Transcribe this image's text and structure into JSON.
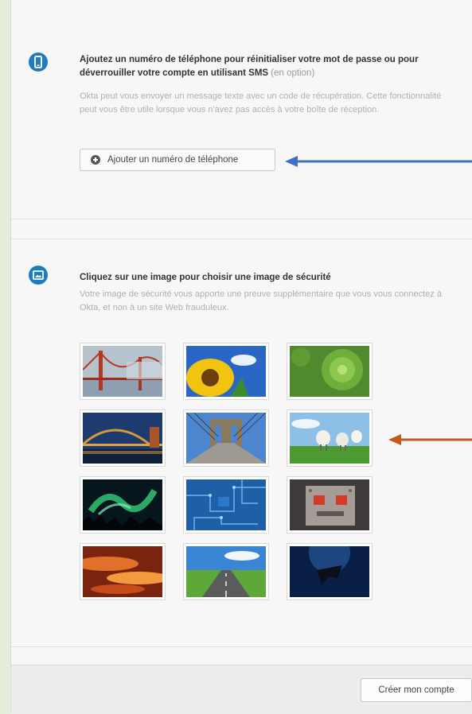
{
  "phone_section": {
    "icon": "phone-icon",
    "title": "Ajoutez un numéro de téléphone pour réinitialiser votre mot de passe ou pour déverrouiller votre compte en utilisant SMS",
    "optional": "(en option)",
    "description": "Okta peut vous envoyer un message texte avec un code de récupération. Cette fonctionnalité peut vous être utile lorsque vous n'avez pas accès à votre boîte de réception.",
    "add_button": "Ajouter un numéro de téléphone"
  },
  "security_image_section": {
    "icon": "image-icon",
    "title": "Cliquez sur une image pour choisir une image de sécurité",
    "description": "Votre image de sécurité vous apporte une preuve supplémentaire que vous vous connectez à Okta, et non à un site Web frauduleux.",
    "images": [
      "golden-gate-bridge",
      "sunflower",
      "green-succulent",
      "harbour-bridge-night",
      "brooklyn-bridge",
      "lambs-in-field",
      "aurora-borealis",
      "circuit-board",
      "robot-toy",
      "sunset-clouds",
      "open-road",
      "manta-ray"
    ]
  },
  "footer": {
    "create_button": "Créer mon compte"
  },
  "colors": {
    "accent_blue": "#1e7cc2",
    "arrow_blue": "#3f6fc6",
    "arrow_orange": "#c25a1c",
    "page_green": "#e3eedb"
  }
}
